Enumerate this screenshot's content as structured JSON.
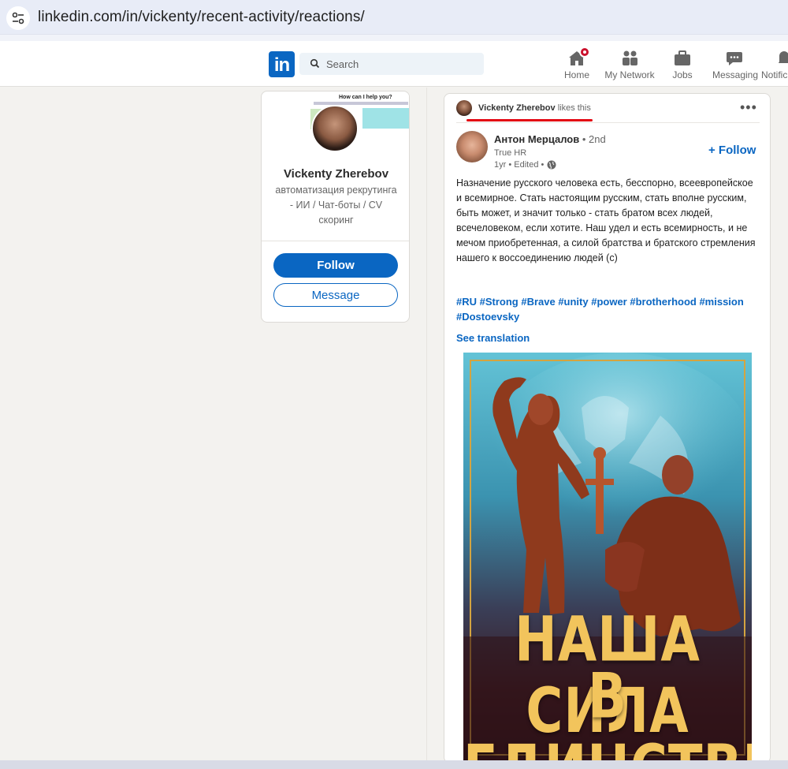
{
  "browser": {
    "url": "linkedin.com/in/vickenty/recent-activity/reactions/"
  },
  "nav": {
    "search_placeholder": "Search",
    "items": [
      {
        "label": "Home",
        "icon": "home-icon"
      },
      {
        "label": "My Network",
        "icon": "network-icon"
      },
      {
        "label": "Jobs",
        "icon": "briefcase-icon"
      },
      {
        "label": "Messaging",
        "icon": "messaging-icon"
      },
      {
        "label": "Notific",
        "icon": "bell-icon"
      }
    ],
    "brand_color": "#0a66c2"
  },
  "profile": {
    "banner_title": "How can I help you?",
    "name": "Vickenty Zherebov",
    "headline": "автоматизация рекрутинга - ИИ / Чат-боты / CV скоринг",
    "follow_label": "Follow",
    "message_label": "Message"
  },
  "post": {
    "activity_name": "Vickenty Zherebov",
    "activity_suffix": "likes this",
    "author_name": "Антон Мерцалов",
    "author_degree": "• 2nd",
    "author_company": "True HR",
    "author_meta": "1yr • Edited •",
    "follow_label": "+ Follow",
    "text": "Назначение русского человека есть, бесспорно, всеевропейское и всемирное. Стать настоящим русским, стать вполне русским, быть может, и значит только - стать братом всех людей, всечеловеком, если хотите. Наш удел и есть всемирность, и не мечом приобретенная, а силой братства и братского стремления нашего к воссоединению людей (с)",
    "hashtags": "#RU #Strong #Brave #unity #power #brotherhood #mission #Dostoevsky",
    "see_translation": "See translation",
    "image_text_line1": "НАША СИЛА",
    "image_text_line2": "В ЕДИНСТВЕ"
  }
}
